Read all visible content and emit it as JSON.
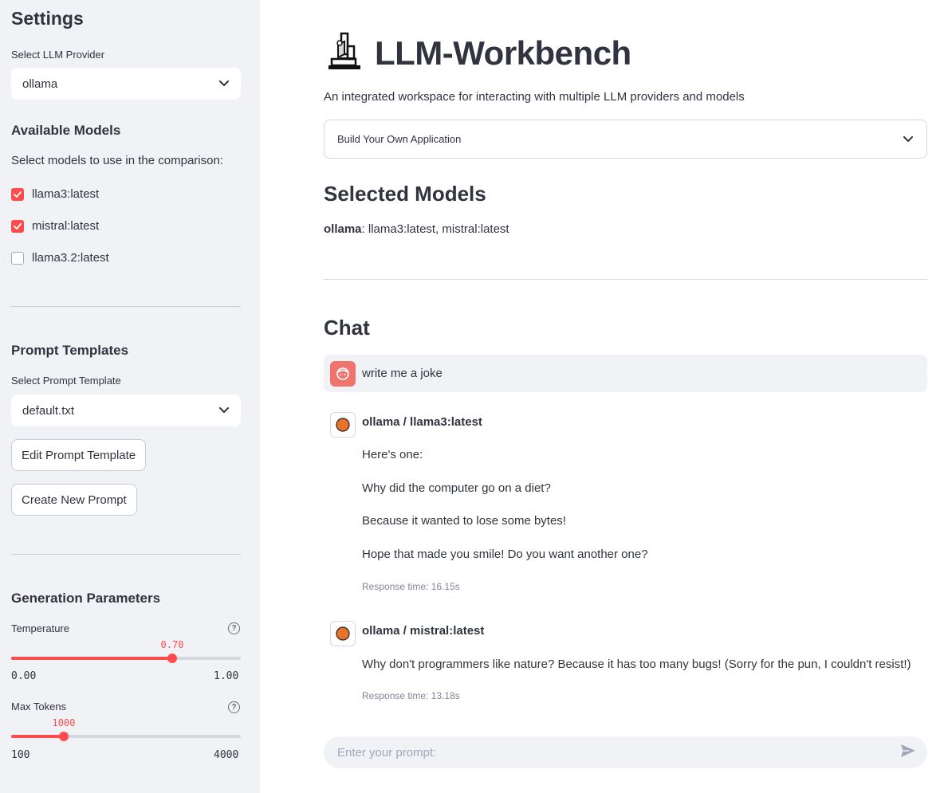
{
  "sidebar": {
    "title": "Settings",
    "provider": {
      "label": "Select LLM Provider",
      "value": "ollama"
    },
    "available_models": {
      "heading": "Available Models",
      "description": "Select models to use in the comparison:",
      "items": [
        {
          "label": "llama3:latest",
          "checked": true
        },
        {
          "label": "mistral:latest",
          "checked": true
        },
        {
          "label": "llama3.2:latest",
          "checked": false
        }
      ]
    },
    "prompt_templates": {
      "heading": "Prompt Templates",
      "select_label": "Select Prompt Template",
      "value": "default.txt",
      "edit_button": "Edit Prompt Template",
      "create_button": "Create New Prompt"
    },
    "generation": {
      "heading": "Generation Parameters",
      "temperature": {
        "label": "Temperature",
        "value": "0.70",
        "min": "0.00",
        "max": "1.00",
        "fraction": 0.7
      },
      "max_tokens": {
        "label": "Max Tokens",
        "value": "1000",
        "min": "100",
        "max": "4000",
        "fraction": 0.2308
      }
    }
  },
  "main": {
    "title": "LLM-Workbench",
    "subtitle": "An integrated workspace for interacting with multiple LLM providers and models",
    "expander_label": "Build Your Own Application",
    "selected_models": {
      "heading": "Selected Models",
      "provider": "ollama",
      "models": ": llama3:latest, mistral:latest"
    },
    "chat": {
      "heading": "Chat",
      "user_message": "write me a joke",
      "responses": [
        {
          "name": "ollama / llama3:latest",
          "lines": [
            "Here's one:",
            "Why did the computer go on a diet?",
            "Because it wanted to lose some bytes!",
            "Hope that made you smile! Do you want another one?"
          ],
          "response_time": "Response time: 16.15s"
        },
        {
          "name": "ollama / mistral:latest",
          "lines": [
            "Why don't programmers like nature? Because it has too many bugs! (Sorry for the pun, I couldn't resist!)"
          ],
          "response_time": "Response time: 13.18s"
        }
      ],
      "input_placeholder": "Enter your prompt:"
    }
  },
  "colors": {
    "accent": "#ff4b4b",
    "sidebar_bg": "#f0f2f6",
    "text": "#31333f",
    "bot_avatar": "#e8722a"
  },
  "icons": [
    "microscope-icon",
    "chevron-down-icon",
    "check-icon",
    "help-icon",
    "user-avatar-icon",
    "bot-avatar-icon",
    "send-icon"
  ]
}
